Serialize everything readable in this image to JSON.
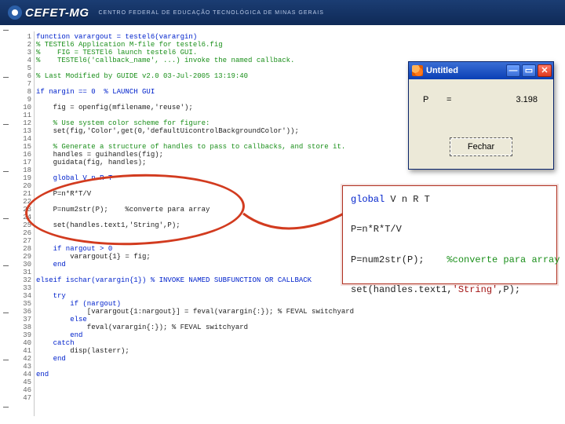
{
  "header": {
    "brand": "CEFET-MG",
    "subtitle": "CENTRO FEDERAL DE EDUCAÇÃO TECNOLÓGICA DE MINAS GERAIS"
  },
  "editor": {
    "line_count": 47,
    "lines": [
      {
        "k": "kw",
        "t": "function varargout = testel6(varargin)"
      },
      {
        "k": "cmt",
        "t": "% TESTEl6 Application M-file for testel6.fig"
      },
      {
        "k": "cmt",
        "t": "%    FIG = TESTEl6 launch testel6 GUI."
      },
      {
        "k": "cmt",
        "t": "%    TESTEl6('callback_name', ...) invoke the named callback."
      },
      {
        "k": "",
        "t": ""
      },
      {
        "k": "cmt",
        "t": "% Last Modified by GUIDE v2.0 03-Jul-2005 13:19:40"
      },
      {
        "k": "",
        "t": ""
      },
      {
        "k": "kw",
        "t": "if nargin == 0  % LAUNCH GUI"
      },
      {
        "k": "",
        "t": ""
      },
      {
        "k": "",
        "t": "    fig = openfig(mfilename,'reuse');"
      },
      {
        "k": "",
        "t": ""
      },
      {
        "k": "cmt",
        "t": "    % Use system color scheme for figure:"
      },
      {
        "k": "",
        "t": "    set(fig,'Color',get(0,'defaultUicontrolBackgroundColor'));"
      },
      {
        "k": "",
        "t": ""
      },
      {
        "k": "cmt",
        "t": "    % Generate a structure of handles to pass to callbacks, and store it."
      },
      {
        "k": "",
        "t": "    handles = guihandles(fig);"
      },
      {
        "k": "",
        "t": "    guidata(fig, handles);"
      },
      {
        "k": "",
        "t": ""
      },
      {
        "k": "kw",
        "t": "    global V n R T"
      },
      {
        "k": "",
        "t": ""
      },
      {
        "k": "",
        "t": "    P=n*R*T/V"
      },
      {
        "k": "",
        "t": ""
      },
      {
        "k": "",
        "t": "    P=num2str(P);    %converte para array"
      },
      {
        "k": "",
        "t": ""
      },
      {
        "k": "",
        "t": "    set(handles.text1,'String',P);"
      },
      {
        "k": "",
        "t": ""
      },
      {
        "k": "",
        "t": ""
      },
      {
        "k": "kw",
        "t": "    if nargout > 0"
      },
      {
        "k": "",
        "t": "        varargout{1} = fig;"
      },
      {
        "k": "kw",
        "t": "    end"
      },
      {
        "k": "",
        "t": ""
      },
      {
        "k": "kw",
        "t": "elseif ischar(varargin{1}) % INVOKE NAMED SUBFUNCTION OR CALLBACK"
      },
      {
        "k": "",
        "t": ""
      },
      {
        "k": "kw",
        "t": "    try"
      },
      {
        "k": "kw",
        "t": "        if (nargout)"
      },
      {
        "k": "",
        "t": "            [varargout{1:nargout}] = feval(varargin{:}); % FEVAL switchyard"
      },
      {
        "k": "kw",
        "t": "        else"
      },
      {
        "k": "",
        "t": "            feval(varargin{:}); % FEVAL switchyard"
      },
      {
        "k": "kw",
        "t": "        end"
      },
      {
        "k": "kw",
        "t": "    catch"
      },
      {
        "k": "",
        "t": "        disp(lasterr);"
      },
      {
        "k": "kw",
        "t": "    end"
      },
      {
        "k": "",
        "t": ""
      },
      {
        "k": "kw",
        "t": "end"
      },
      {
        "k": "",
        "t": ""
      },
      {
        "k": "",
        "t": ""
      },
      {
        "k": "",
        "t": ""
      }
    ]
  },
  "appwindow": {
    "title": "Untitled",
    "min_glyph": "—",
    "max_glyph": "▭",
    "close_glyph": "✕",
    "label_p": "P",
    "label_eq": "=",
    "value": "3.198",
    "close_button": "Fechar"
  },
  "mag": {
    "l1_kw": "global",
    "l1_rest": " V n R T",
    "l2": "P=n*R*T/V",
    "l3a": "P=num2str(P);    ",
    "l3b": "%converte para array",
    "l4a": "set(handles.text1,",
    "l4b": "'String'",
    "l4c": ",P);"
  }
}
